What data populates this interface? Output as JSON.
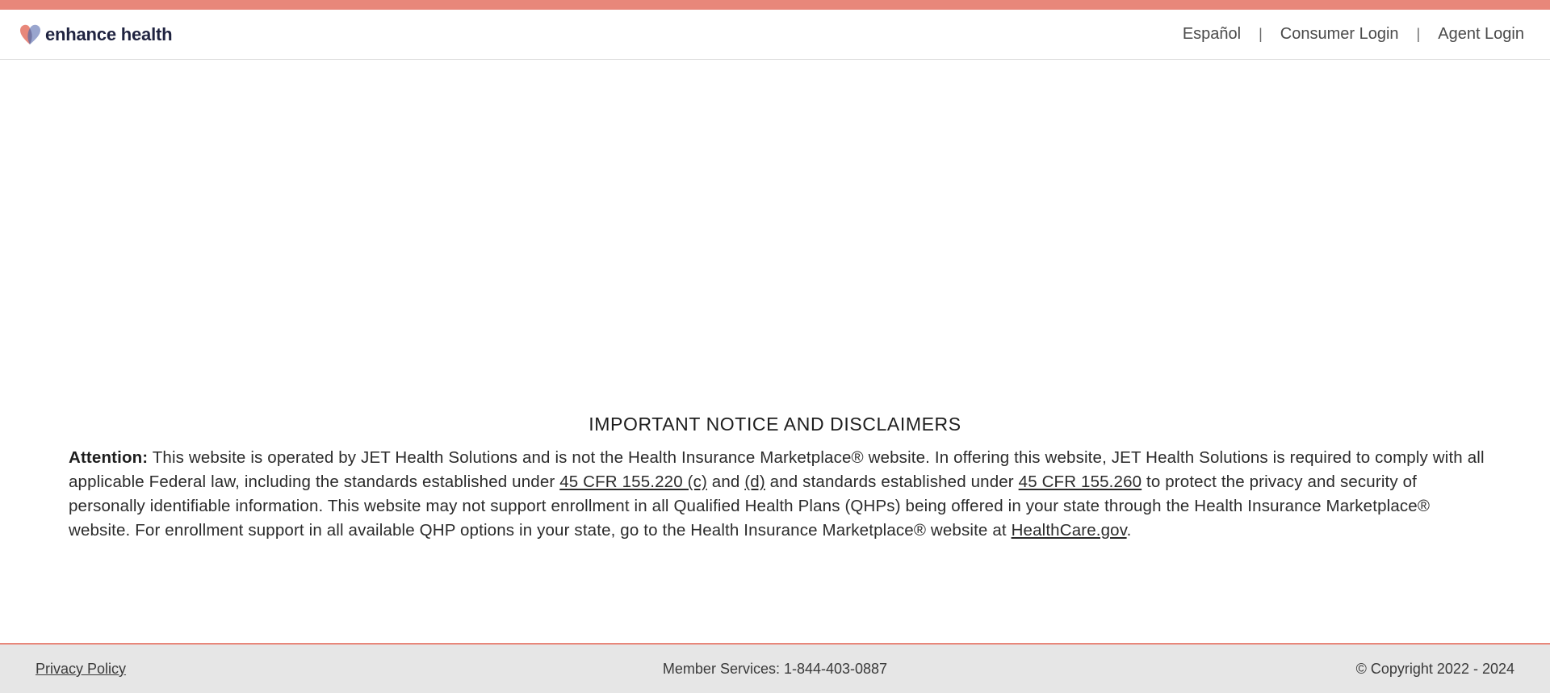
{
  "brand": {
    "name": "enhance health",
    "accent_color": "#E8877A",
    "icon": "heart-logo-icon"
  },
  "nav": {
    "items": [
      {
        "label": "Español"
      },
      {
        "label": "Consumer Login"
      },
      {
        "label": "Agent Login"
      }
    ],
    "separator": "|"
  },
  "notice": {
    "title": "IMPORTANT NOTICE AND DISCLAIMERS",
    "attention_label": "Attention:",
    "text_1": " This website is operated by JET Health Solutions and is not the Health Insurance Marketplace® website. In offering this website, JET Health Solutions is required to comply with all applicable Federal law, including the standards established under ",
    "link_1": "45 CFR 155.220 (c)",
    "text_2": " and ",
    "link_2": "(d)",
    "text_3": " and standards established under ",
    "link_3": "45 CFR 155.260",
    "text_4": " to protect the privacy and security of personally identifiable information. This website may not support enrollment in all Qualified Health Plans (QHPs) being offered in your state through the Health Insurance Marketplace® website. For enrollment support in all available QHP options in your state, go to the Health Insurance Marketplace® website at ",
    "link_4": "HealthCare.gov",
    "text_5": "."
  },
  "footer": {
    "privacy_label": "Privacy Policy",
    "member_services": "Member Services: 1-844-403-0887",
    "copyright": "© Copyright 2022 - 2024"
  }
}
